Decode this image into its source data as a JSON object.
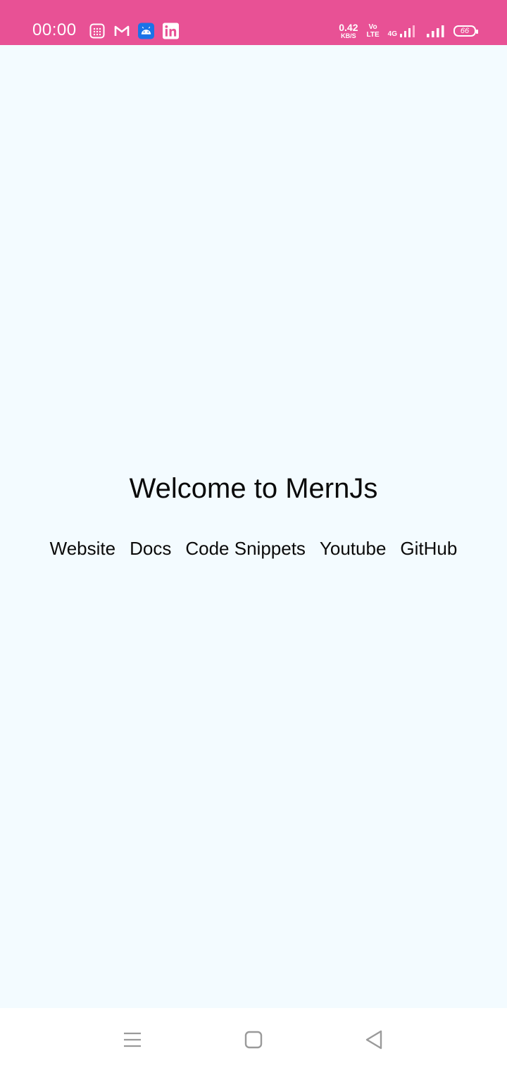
{
  "status_bar": {
    "time": "00:00",
    "notification_icons": [
      "calculator-icon",
      "gmail-icon",
      "android-icon",
      "linkedin-icon"
    ],
    "net_speed_value": "0.42",
    "net_speed_unit": "KB/S",
    "volte_top": "Vo",
    "volte_bottom": "LTE",
    "network_type": "4G",
    "battery_level": "66",
    "background_color": "#e85195"
  },
  "main": {
    "title": "Welcome to MernJs",
    "links": [
      {
        "label": "Website"
      },
      {
        "label": "Docs"
      },
      {
        "label": "Code Snippets"
      },
      {
        "label": "Youtube"
      },
      {
        "label": "GitHub"
      }
    ],
    "background_color": "#f3fbff"
  },
  "nav_bar": {
    "buttons": [
      "menu-icon",
      "home-icon",
      "back-icon"
    ]
  }
}
